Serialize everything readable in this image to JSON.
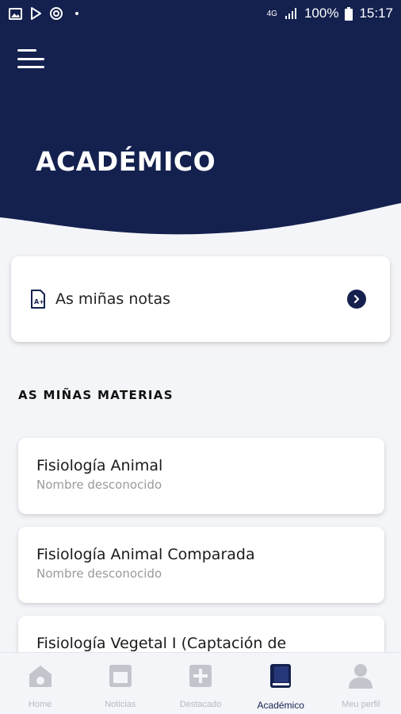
{
  "status_bar": {
    "network": "4G",
    "battery": "100%",
    "time": "15:17"
  },
  "header": {
    "title": "ACADÉMICO",
    "background_color": "#14214f"
  },
  "notes_card": {
    "label": "As miñas notas"
  },
  "subjects_section": {
    "title": "AS MIÑAS MATERIAS",
    "items": [
      {
        "name": "Fisiología Animal",
        "subtitle": "Nombre desconocido"
      },
      {
        "name": "Fisiología Animal Comparada",
        "subtitle": "Nombre desconocido"
      },
      {
        "name": "Fisiología Vegetal I (Captación de",
        "subtitle": ""
      }
    ]
  },
  "bottom_nav": {
    "items": [
      {
        "label": "Home",
        "icon": "home-icon",
        "active": false
      },
      {
        "label": "Noticias",
        "icon": "news-icon",
        "active": false
      },
      {
        "label": "Destacado",
        "icon": "plus-box-icon",
        "active": false
      },
      {
        "label": "Académico",
        "icon": "book-icon",
        "active": true
      },
      {
        "label": "Meu perfil",
        "icon": "person-icon",
        "active": false
      }
    ],
    "active_color": "#14214f",
    "inactive_color": "#c3c5cc"
  }
}
